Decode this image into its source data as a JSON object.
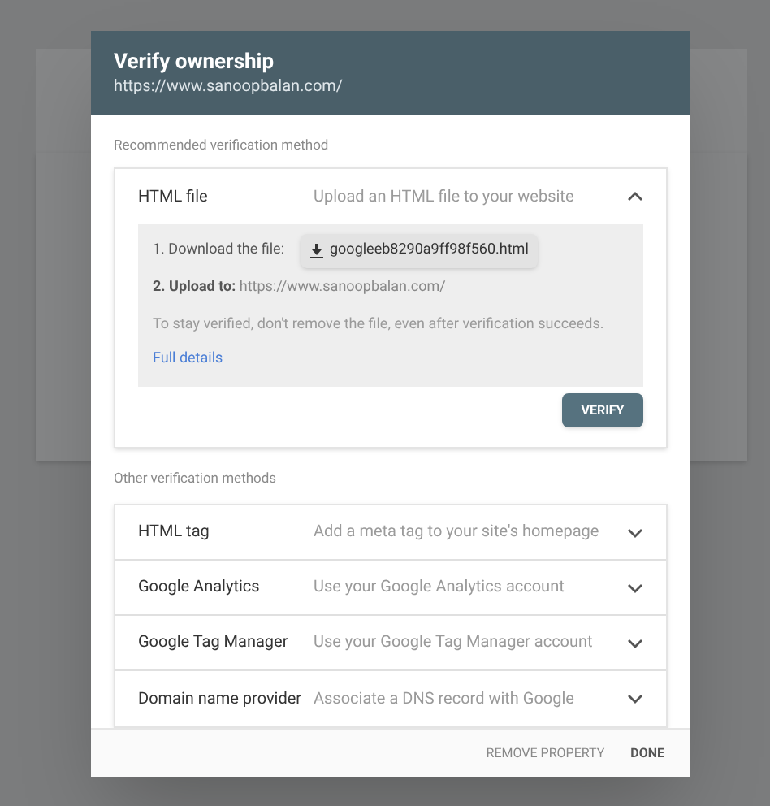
{
  "dialog": {
    "title": "Verify ownership",
    "subtitle": "https://www.sanoopbalan.com/"
  },
  "recommended": {
    "heading": "Recommended verification method",
    "method": {
      "name": "HTML file",
      "description": "Upload an HTML file to your website",
      "expanded": true
    },
    "steps": {
      "download_label": "1. Download the file:",
      "file_button": "googleeb8290a9ff98f560.html",
      "upload": "**2. Upload to:** https://www.sanoopbalan.com/",
      "note": "To stay verified, don't remove the file, even after verification succeeds.",
      "link": "Full details"
    },
    "verify_button": "VERIFY"
  },
  "other": {
    "heading": "Other verification methods",
    "methods": [
      {
        "name": "HTML tag",
        "description": "Add a meta tag to your site's homepage",
        "expanded": false
      },
      {
        "name": "Google Analytics",
        "description": "Use your Google Analytics account",
        "expanded": false
      },
      {
        "name": "Google Tag Manager",
        "description": "Use your Google Tag Manager account",
        "expanded": false
      },
      {
        "name": "Domain name provider",
        "description": "Associate a DNS record with Google",
        "expanded": false
      }
    ]
  },
  "footer": {
    "buttons": [
      "REMOVE PROPERTY",
      "DONE"
    ]
  }
}
